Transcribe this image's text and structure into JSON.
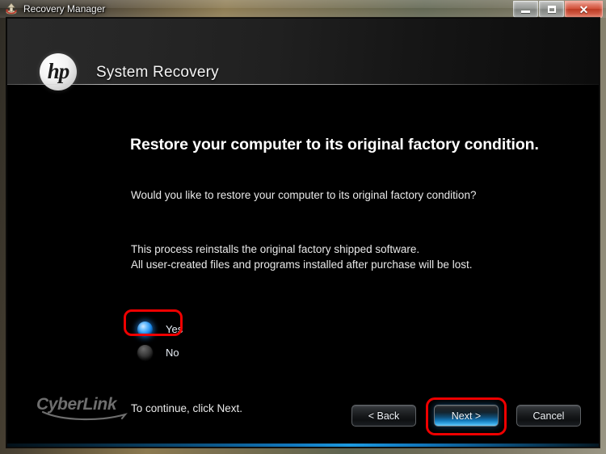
{
  "window": {
    "title": "Recovery Manager",
    "app_icon": "recovery-manager-icon",
    "controls": {
      "minimize_label": "–",
      "maximize_label": "□",
      "close_label": "✕"
    }
  },
  "header": {
    "brand_logo": "hp",
    "title": "System Recovery"
  },
  "content": {
    "heading": "Restore your computer to its original factory condition.",
    "question": "Would you like to restore your computer to its original factory condition?",
    "paragraph_line_1": "This process reinstalls the original factory shipped software.",
    "paragraph_line_2": "All user-created files and programs installed after purchase will be lost.",
    "continue_text": "To continue, click Next."
  },
  "options": {
    "selected": "Yes",
    "items": [
      {
        "label": "Yes",
        "selected": true
      },
      {
        "label": "No",
        "selected": false
      }
    ]
  },
  "footer": {
    "vendor_logo": "CyberLink"
  },
  "buttons": {
    "back": "< Back",
    "next": "Next >",
    "cancel": "Cancel"
  },
  "annotations": {
    "highlight_color": "#ee0000",
    "highlighted_targets": [
      "yes-radio-option",
      "next-button"
    ]
  },
  "colors": {
    "accent_blue": "#1d9ae0",
    "radio_selected": "#1a8cf0",
    "background": "#000000",
    "header_gradient_start": "#2a2a2a",
    "header_gradient_end": "#0c0c0c"
  }
}
